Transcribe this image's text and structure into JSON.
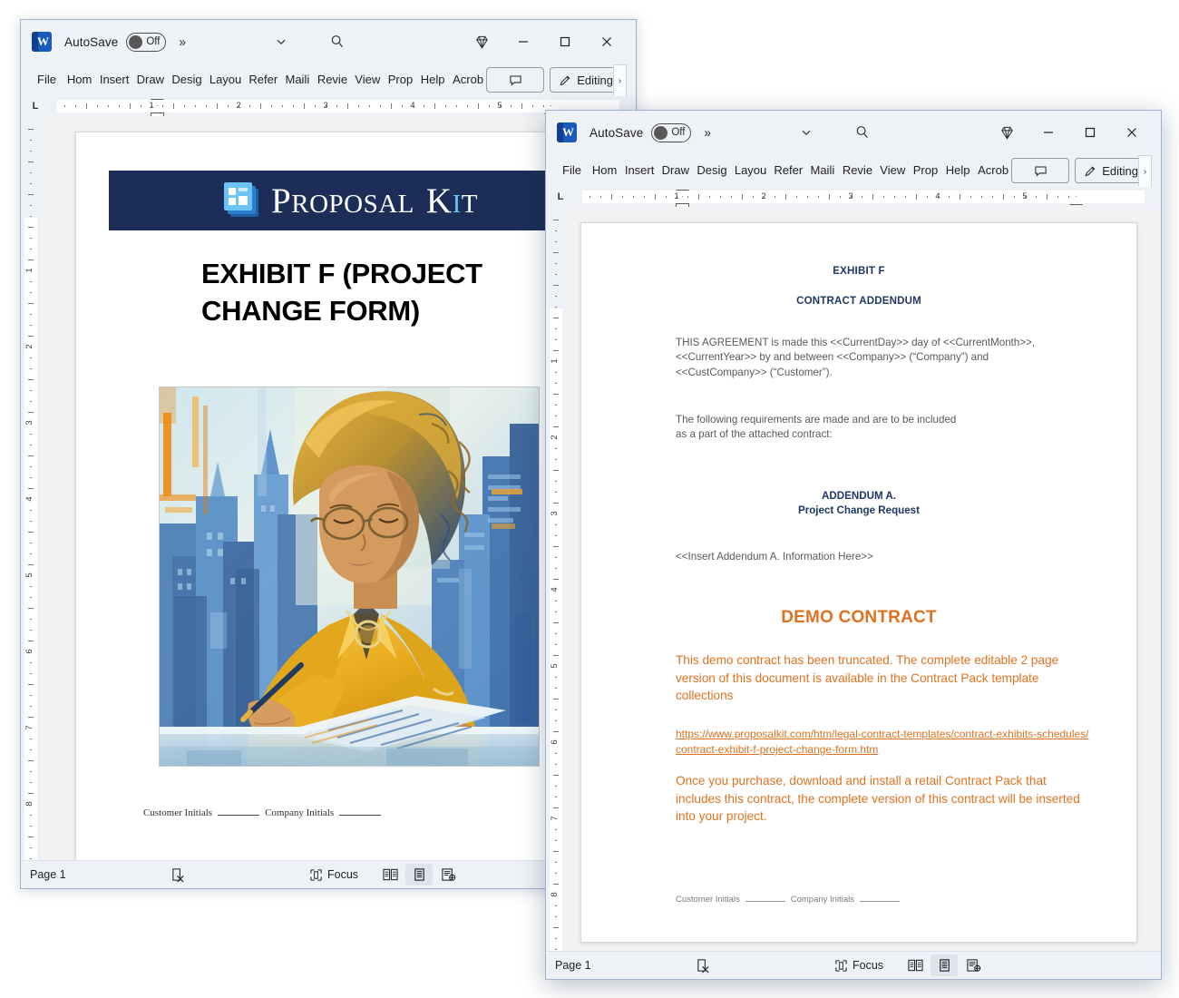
{
  "app": {
    "autosave_label": "AutoSave",
    "autosave_state": "Off",
    "overflow_glyph": "»",
    "icons": {
      "word_letter": "W",
      "chevron_down": "chevron-down-icon",
      "search": "search-icon",
      "diamond": "diamond-icon",
      "minimize": "minimize-icon",
      "maximize": "maximize-icon",
      "close": "close-icon"
    }
  },
  "ribbon": {
    "tabs": [
      "File",
      "Home",
      "Insert",
      "Draw",
      "Design",
      "Layout",
      "References",
      "Mailings",
      "Review",
      "View",
      "Properties",
      "Help",
      "Acrobat"
    ],
    "tabs_clipped": [
      "File",
      "Hom",
      "Insert",
      "Draw",
      "Desig",
      "Layou",
      "Refer",
      "Maili",
      "Revie",
      "View",
      "Prop",
      "Help",
      "Acrob"
    ],
    "comment_button": "comment-button",
    "editing_label": "Editing",
    "more_glyph": "›"
  },
  "ruler": {
    "tab_selector": "L",
    "h_numbers": [
      "1",
      "2",
      "3",
      "4",
      "5"
    ],
    "v_numbers": [
      "1",
      "2",
      "3",
      "4",
      "5",
      "6",
      "7",
      "8"
    ]
  },
  "statusbar": {
    "page": "Page 1",
    "focus": "Focus",
    "spell_icon": "spell-check-icon",
    "views": [
      "read-mode-icon",
      "print-layout-icon",
      "web-layout-icon"
    ],
    "active_view_index": 1
  },
  "back_document": {
    "banner": {
      "brand_word1": "Proposal",
      "brand_word2": "Kit",
      "bg_color": "#1c2e57",
      "logo": "proposal-kit-logo"
    },
    "heading": "EXHIBIT F (PROJECT CHANGE FORM)",
    "illustration_alt": "Painted illustration of a woman in a yellow shirt writing at a desk with an abstract blue city skyline behind her",
    "footer": {
      "customer_initials_label": "Customer Initials",
      "company_initials_label": "Company Initials"
    }
  },
  "front_document": {
    "title1": "EXHIBIT F",
    "title2": "CONTRACT ADDENDUM",
    "agreement_paragraph": "THIS AGREEMENT is made this <<CurrentDay>> day of <<CurrentMonth>>, <<CurrentYear>> by and between <<Company>> (“Company”) and <<CustCompany>> (“Customer”).",
    "requirements_paragraph": "The following requirements are made and are to be included\n as a part of the attached contract:",
    "addendum_label": "ADDENDUM A.",
    "addendum_subtitle": "Project Change Request",
    "insert_placeholder": "<<Insert Addendum A. Information Here>>",
    "demo_title": "DEMO CONTRACT",
    "demo_paragraph": "This demo contract has been truncated. The complete editable 2 page version of this document is available in the Contract Pack template collections",
    "demo_link": "https://www.proposalkit.com/htm/legal-contract-templates/contract-exhibits-schedules/contract-exhibit-f-project-change-form.htm",
    "purchase_paragraph": "Once you purchase, download and install a retail Contract Pack that includes this contract, the complete version of this contract will be inserted into your project.",
    "footer": {
      "customer_initials_label": "Customer Initials",
      "company_initials_label": "Company Initials"
    },
    "colors": {
      "heading_navy": "#1f3864",
      "body_gray": "#595959",
      "accent_orange": "#e0711f"
    }
  }
}
